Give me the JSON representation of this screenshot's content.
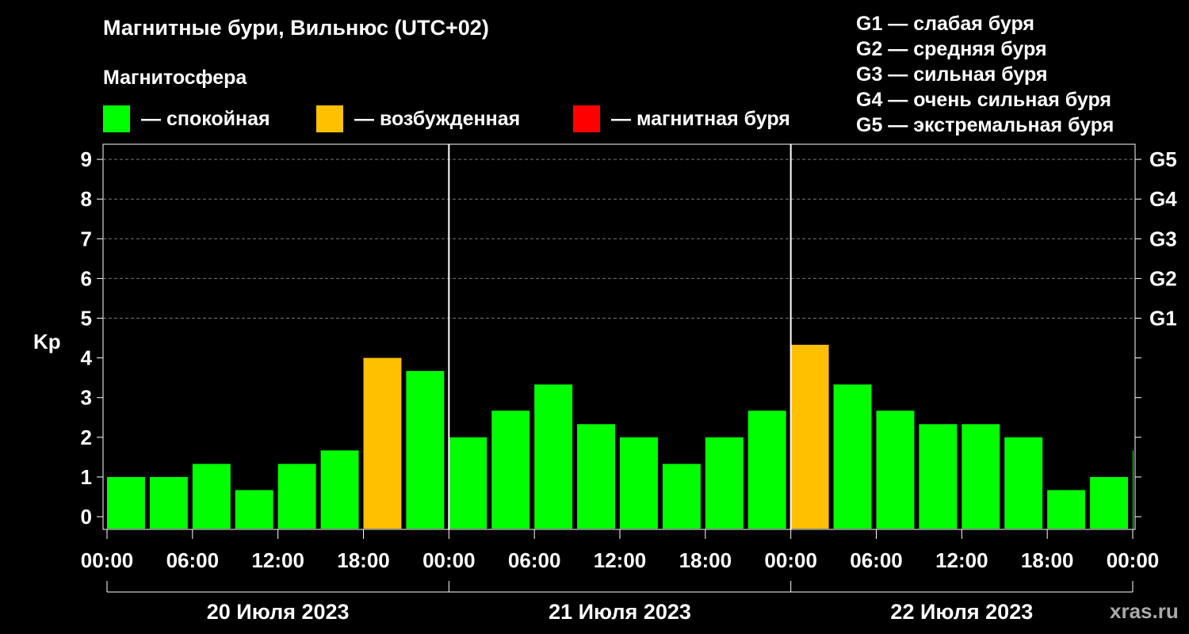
{
  "title": "Магнитные бури, Вильнюс (UTC+02)",
  "subtitle": "Магнитосфера",
  "legend": [
    {
      "label": "— спокойная",
      "color": "#00ff00"
    },
    {
      "label": "— возбужденная",
      "color": "#ffc000"
    },
    {
      "label": "— магнитная буря",
      "color": "#ff0000"
    }
  ],
  "g_scale": [
    "G1 — слабая буря",
    "G2 — средняя буря",
    "G3 — сильная буря",
    "G4 — очень сильная буря",
    "G5 — экстремальная буря"
  ],
  "watermark": "xras.ru",
  "chart_data": {
    "type": "bar",
    "ylabel": "Kp",
    "ylim": [
      0,
      9
    ],
    "y_ticks": [
      0,
      1,
      2,
      3,
      4,
      5,
      6,
      7,
      8,
      9
    ],
    "right_labels": [
      {
        "y": 5,
        "label": "G1"
      },
      {
        "y": 6,
        "label": "G2"
      },
      {
        "y": 7,
        "label": "G3"
      },
      {
        "y": 8,
        "label": "G4"
      },
      {
        "y": 9,
        "label": "G5"
      }
    ],
    "grid": "dashed horizontal at 5–9",
    "x_tick_labels": [
      "00:00",
      "06:00",
      "12:00",
      "18:00",
      "00:00",
      "06:00",
      "12:00",
      "18:00",
      "00:00",
      "06:00",
      "12:00",
      "18:00",
      "00:00"
    ],
    "days": [
      "20 Июля 2023",
      "21 Июля 2023",
      "22 Июля 2023"
    ],
    "interval_hours": 3,
    "values": [
      1.0,
      1.0,
      1.33,
      0.67,
      1.33,
      1.67,
      4.0,
      3.67,
      2.0,
      2.67,
      3.33,
      2.33,
      2.0,
      1.33,
      2.0,
      2.67,
      4.33,
      3.33,
      2.67,
      2.33,
      2.33,
      2.0,
      0.67,
      1.0,
      1.67
    ],
    "colors": {
      "quiet": "#00ff00",
      "active": "#ffc000",
      "storm": "#ff0000"
    }
  }
}
